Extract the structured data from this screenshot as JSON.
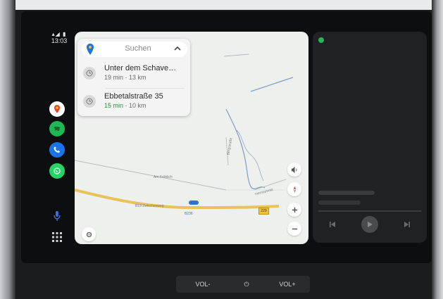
{
  "status": {
    "signal": "⌃▲ ▮",
    "time": "13:03"
  },
  "rail": {
    "apps": [
      {
        "name": "maps",
        "color": "#ffffff"
      },
      {
        "name": "spotify",
        "color": "#1db954"
      },
      {
        "name": "phone",
        "color": "#1a73e8"
      },
      {
        "name": "whatsapp",
        "color": "#25d366"
      }
    ]
  },
  "map": {
    "search_label": "Suchen",
    "destinations": [
      {
        "name": "Unter dem Schave…",
        "meta": "19 min · 13 km",
        "eta": ""
      },
      {
        "name": "Ebbetalstraße 35",
        "eta": "15 min",
        "meta_rest": " · 10 km"
      }
    ],
    "labels": {
      "street1": "Am Fröhlich",
      "street2": "B13 Zwischenweg",
      "street3": "B236",
      "road_shield": "229",
      "vertical_road": "Bergstraße",
      "diag_road": "Hermannstr."
    }
  },
  "colors": {
    "accent": "#1a73e8",
    "road_major": "#e8c25a",
    "eta_green": "#2e8b3d"
  },
  "hardware": {
    "vol_down": "VOL-",
    "power": "⏻",
    "vol_up": "VOL+"
  }
}
